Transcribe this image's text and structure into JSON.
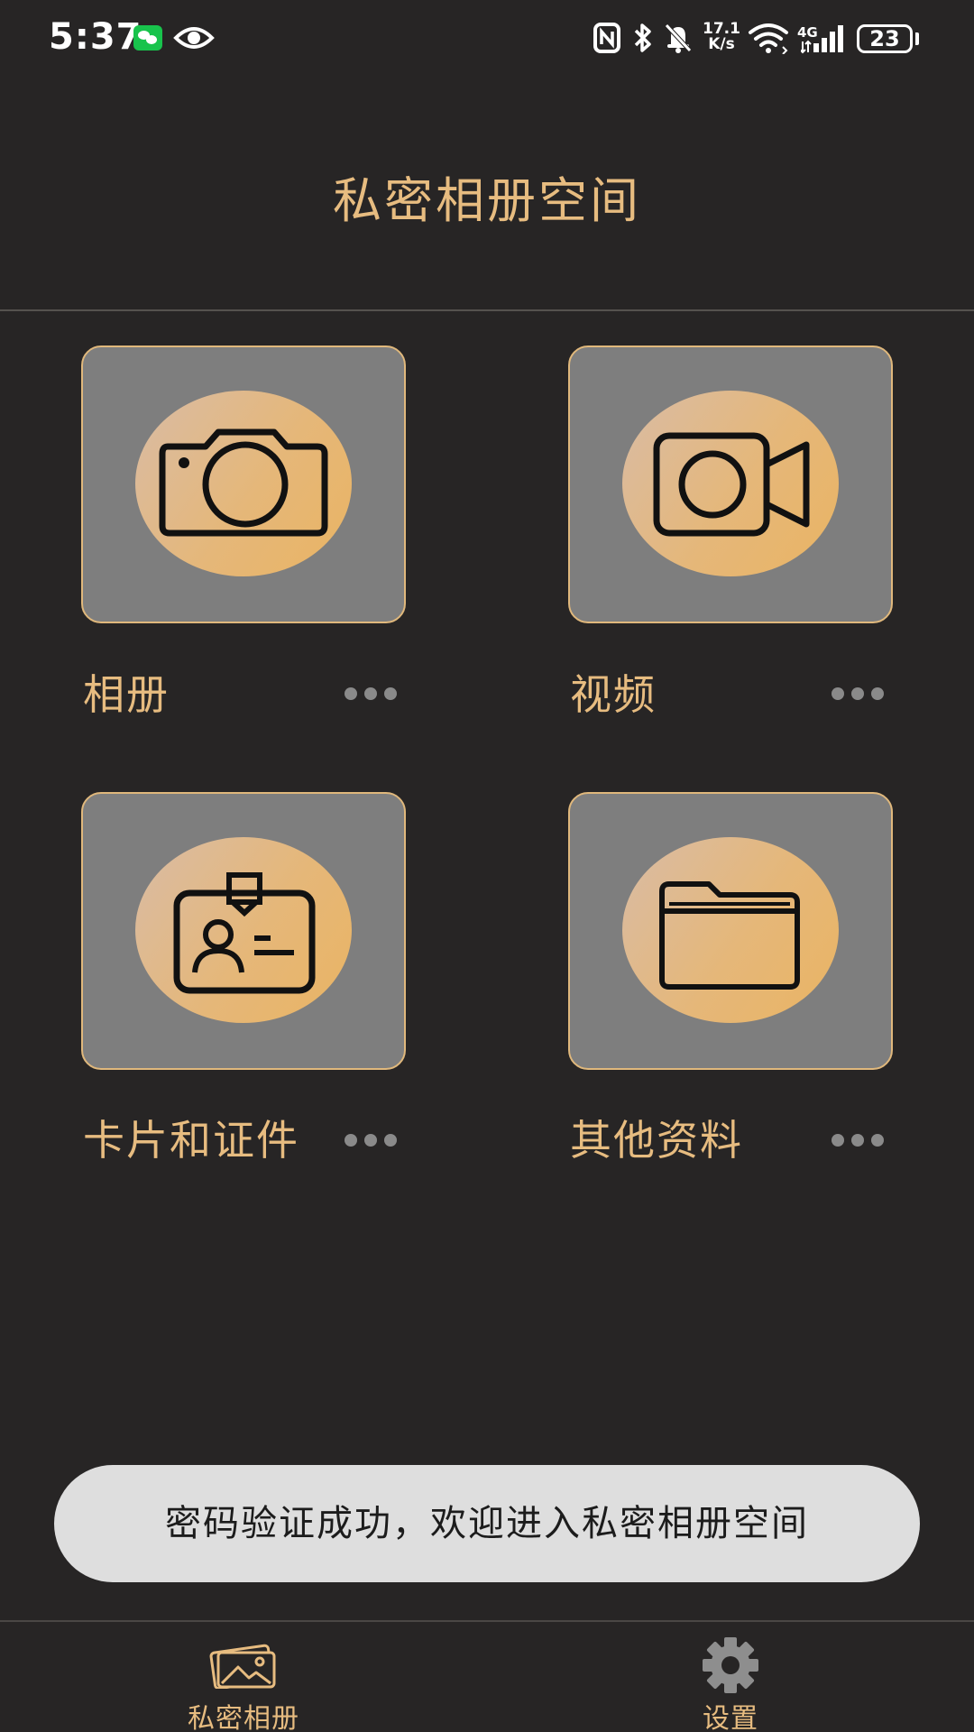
{
  "status_bar": {
    "time": "5:37",
    "net_speed_value": "17.1",
    "net_speed_unit": "K/s",
    "network_type": "4G",
    "battery_level": "23",
    "icons": [
      "wechat-icon",
      "eye-icon",
      "nfc-icon",
      "bluetooth-icon",
      "bell-off-icon",
      "wifi-icon",
      "signal-icon",
      "battery-icon"
    ]
  },
  "header": {
    "title": "私密相册空间"
  },
  "categories": [
    {
      "label": "相册",
      "icon": "camera-icon"
    },
    {
      "label": "视频",
      "icon": "video-camera-icon"
    },
    {
      "label": "卡片和证件",
      "icon": "id-card-icon"
    },
    {
      "label": "其他资料",
      "icon": "folder-icon"
    }
  ],
  "toast": {
    "message": "密码验证成功，欢迎进入私密相册空间"
  },
  "bottom_nav": {
    "items": [
      {
        "label": "私密相册",
        "icon": "photo-album-icon",
        "active": true
      },
      {
        "label": "设置",
        "icon": "gear-icon",
        "active": false
      }
    ]
  },
  "colors": {
    "background": "#272525",
    "accent_gold": "#e7bc80",
    "tile_gray": "#7e7e7e",
    "toast_bg": "#dedede"
  }
}
